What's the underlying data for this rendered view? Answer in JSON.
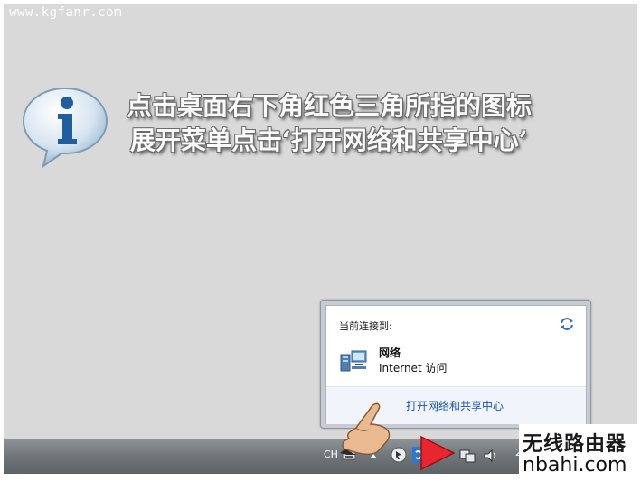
{
  "watermark": "www.kgfanr.com",
  "headline": {
    "line1": "点击桌面右下角红色三角所指的图标",
    "line2": "展开菜单点击‘打开网络和共享中心’"
  },
  "popup": {
    "title": "当前连接到:",
    "network_name": "网络",
    "network_status": "Internet 访问",
    "link_label": "打开网络和共享中心"
  },
  "taskbar": {
    "language": "CH",
    "clock_partial": "2"
  },
  "icons": {
    "info": "info-icon",
    "refresh": "refresh-icon",
    "network": "network-icon",
    "hand": "pointing-hand-icon",
    "arrow": "red-triangle-arrow-icon",
    "volume": "speaker-icon"
  },
  "logo": {
    "chinese": "无线路由器",
    "domain": "nbahi.com"
  },
  "colors": {
    "desktop": "#d9d9d9",
    "link": "#1b56b4",
    "arrow": "#e8262e"
  }
}
